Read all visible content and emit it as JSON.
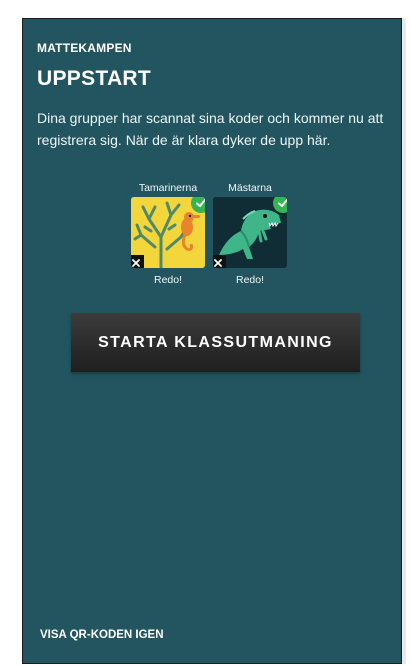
{
  "app": {
    "brand": "MATTEKAMPEN"
  },
  "page": {
    "title": "UPPSTART",
    "description": "Dina grupper har scannat sina koder och kommer nu att registrera sig. När de är klara dyker de upp här."
  },
  "groups": [
    {
      "name": "Tamarinerna",
      "status": "Redo!",
      "avatar": "seahorse-coral-icon",
      "tile_color": "#f2d43a"
    },
    {
      "name": "Mästarna",
      "status": "Redo!",
      "avatar": "dinosaur-icon",
      "tile_color": "#0f2a33"
    }
  ],
  "actions": {
    "start_label": "STARTA KLASSUTMANING",
    "show_qr_label": "VISA QR-KODEN IGEN"
  },
  "colors": {
    "panel": "#22555f",
    "check": "#35b552",
    "button": "#2b2b2b"
  }
}
